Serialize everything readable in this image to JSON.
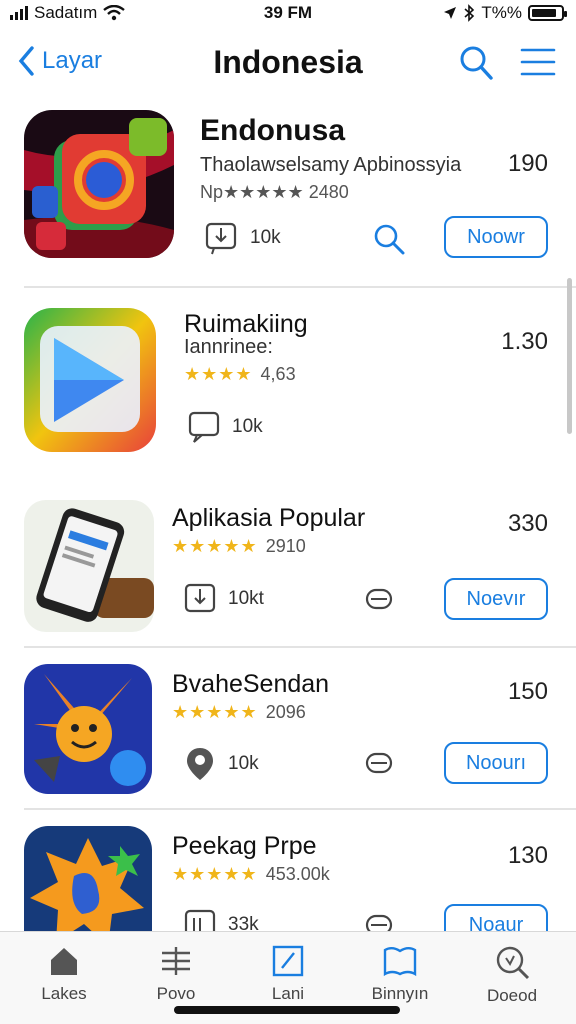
{
  "status": {
    "carrier": "Sadatım",
    "time": "39 FM",
    "battery": "T%%"
  },
  "nav": {
    "back_label": "Layar",
    "title": "Indonesia"
  },
  "apps": [
    {
      "name": "Endonusa",
      "subtitle": "Thaolawselsamy Apbinossyia",
      "rating_text": "Np★★★★★ 2480",
      "price": "190",
      "downloads": "10k",
      "button": "Noowr"
    },
    {
      "name": "Ruimakiing",
      "subtitle": "Iannrinee:",
      "rating_text": "4,63",
      "price": "1.30",
      "downloads": "10k",
      "button": ""
    },
    {
      "name": "Aplikasia Popular",
      "subtitle": "",
      "rating_text": "2910",
      "price": "330",
      "downloads": "10kt",
      "button": "Noevır"
    },
    {
      "name": "BvaheSendan",
      "subtitle": "",
      "rating_text": "2096",
      "price": "150",
      "downloads": "10k",
      "button": "Noourı"
    },
    {
      "name": "Peekag Prpe",
      "subtitle": "",
      "rating_text": "453.00k",
      "price": "130",
      "downloads": "33k",
      "button": "Noaur"
    }
  ],
  "tabs": [
    {
      "label": "Lakes",
      "icon": "home-icon"
    },
    {
      "label": "Povo",
      "icon": "sliders-icon"
    },
    {
      "label": "Lani",
      "icon": "edit-icon"
    },
    {
      "label": "Binnyın",
      "icon": "book-icon"
    },
    {
      "label": "Doeod",
      "icon": "search-icon"
    }
  ],
  "colors": {
    "accent": "#1a7ee0",
    "star": "#f0b51a"
  }
}
